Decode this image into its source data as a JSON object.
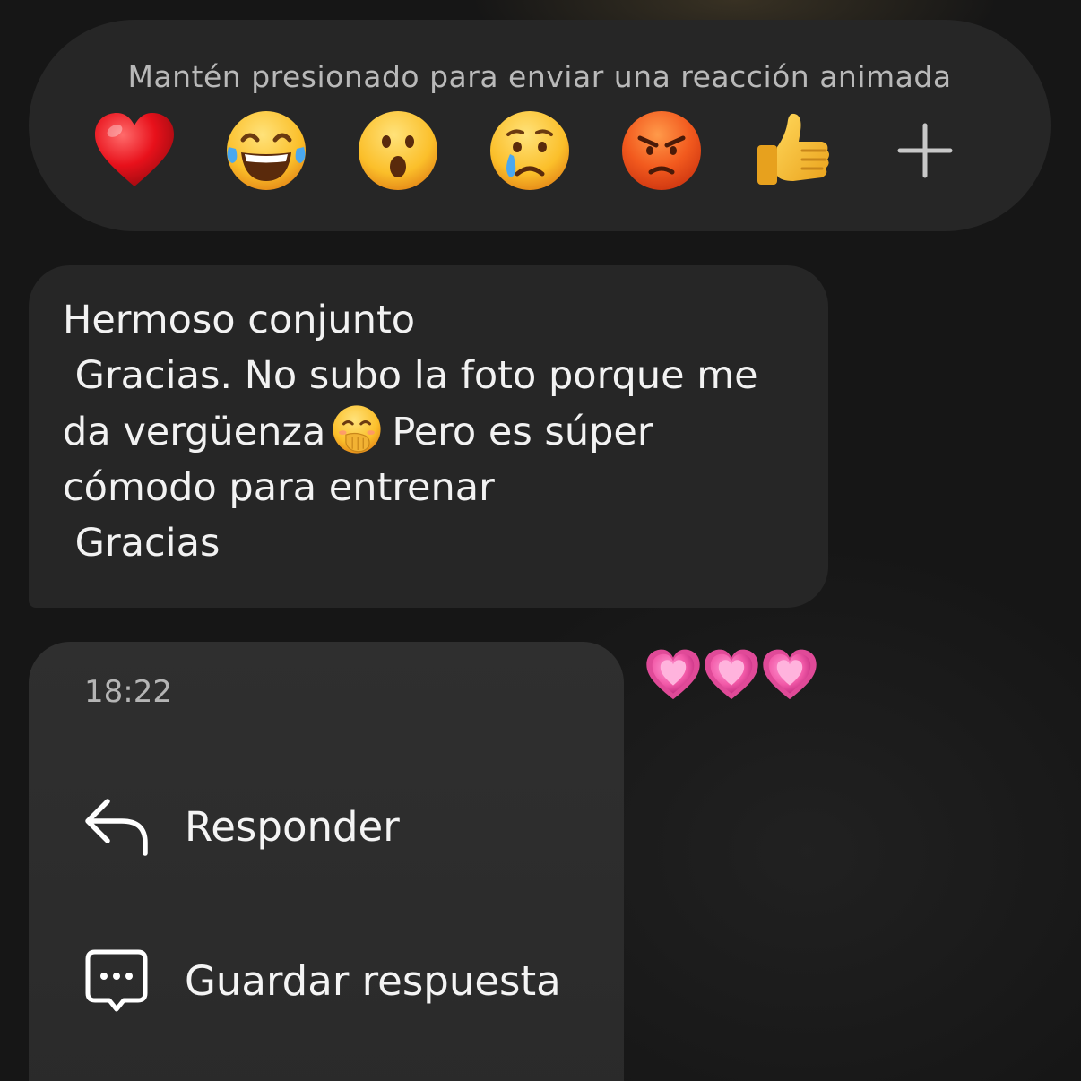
{
  "reaction_bar": {
    "hint": "Mantén presionado para enviar una reacción animada",
    "emojis": [
      {
        "name": "red-heart",
        "glyph": "❤️"
      },
      {
        "name": "tears-of-joy",
        "glyph": "😂"
      },
      {
        "name": "astonished",
        "glyph": "😮"
      },
      {
        "name": "crying",
        "glyph": "😢"
      },
      {
        "name": "angry",
        "glyph": "😡"
      },
      {
        "name": "thumbs-up",
        "glyph": "👍"
      }
    ],
    "more_icon": "plus-icon"
  },
  "message": {
    "lines": [
      "Hermoso conjunto",
      " Gracias. No subo la foto porque me",
      "da vergüenza",
      "Pero es súper",
      "cómodo para entrenar",
      " Gracias"
    ],
    "inline_emoji": "face-with-hand-over-mouth"
  },
  "reactions_received": {
    "emoji": "growing-heart",
    "glyphs": [
      "💗",
      "💗",
      "💗"
    ]
  },
  "context_menu": {
    "timestamp": "18:22",
    "items": [
      {
        "label": "Responder",
        "icon": "reply-arrow-icon"
      },
      {
        "label": "Guardar respuesta",
        "icon": "saved-reply-icon"
      }
    ]
  }
}
